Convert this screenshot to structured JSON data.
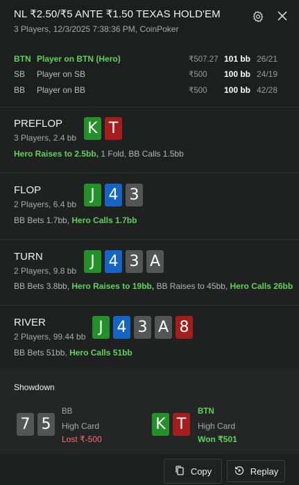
{
  "header": {
    "title": "NL ₹2.50/₹5 ANTE ₹1.50 TEXAS HOLD'EM",
    "subtitle": "3 Players, 12/3/2025 7:38:36 PM, CoinPoker"
  },
  "players": [
    {
      "pos": "BTN",
      "name": "Player on BTN (Hero)",
      "chips": "₹507.27",
      "bb": "101 bb",
      "ratio": "26/21",
      "hero": true
    },
    {
      "pos": "SB",
      "name": "Player on SB",
      "chips": "₹500",
      "bb": "100 bb",
      "ratio": "24/19",
      "hero": false
    },
    {
      "pos": "BB",
      "name": "Player on BB",
      "chips": "₹500",
      "bb": "100 bb",
      "ratio": "42/28",
      "hero": false
    }
  ],
  "streets": {
    "preflop": {
      "name": "PREFLOP",
      "info": "3 Players, 2.4 bb",
      "cards": [
        {
          "rank": "K",
          "color": "green"
        },
        {
          "rank": "T",
          "color": "red"
        }
      ],
      "action_hero": "Hero Raises to 2.5bb,",
      "action_rest": " 1 Fold, BB Calls 1.5bb"
    },
    "flop": {
      "name": "FLOP",
      "info": "2 Players, 6.4 bb",
      "cards": [
        {
          "rank": "J",
          "color": "green"
        },
        {
          "rank": "4",
          "color": "blue"
        },
        {
          "rank": "3",
          "color": "gray"
        }
      ],
      "action_pre": "BB Bets 1.7bb, ",
      "action_hero": "Hero Calls 1.7bb"
    },
    "turn": {
      "name": "TURN",
      "info": "2 Players, 9.8 bb",
      "cards": [
        {
          "rank": "J",
          "color": "green"
        },
        {
          "rank": "4",
          "color": "blue"
        },
        {
          "rank": "3",
          "color": "gray"
        },
        {
          "rank": "A",
          "color": "gray"
        }
      ],
      "action_pre": "BB Bets 3.8bb, ",
      "action_hero1": "Hero Raises to 19bb,",
      "action_mid": " BB Raises to 45bb, ",
      "action_hero2": "Hero Calls 26bb"
    },
    "river": {
      "name": "RIVER",
      "info": "2 Players, 99.44 bb",
      "cards": [
        {
          "rank": "J",
          "color": "green"
        },
        {
          "rank": "4",
          "color": "blue"
        },
        {
          "rank": "3",
          "color": "gray"
        },
        {
          "rank": "A",
          "color": "gray"
        },
        {
          "rank": "8",
          "color": "red"
        }
      ],
      "action_pre": "BB Bets 51bb, ",
      "action_hero": "Hero Calls 51bb"
    }
  },
  "showdown": {
    "title": "Showdown",
    "left": {
      "cards": [
        {
          "rank": "7",
          "color": "gray"
        },
        {
          "rank": "5",
          "color": "gray"
        }
      ],
      "pos": "BB",
      "hand": "High Card",
      "result": "Lost ₹-500"
    },
    "right": {
      "cards": [
        {
          "rank": "K",
          "color": "green"
        },
        {
          "rank": "T",
          "color": "red"
        }
      ],
      "pos": "BTN",
      "hand": "High Card",
      "result": "Won ₹501"
    }
  },
  "footer": {
    "copy_label": "Copy",
    "replay_label": "Replay"
  },
  "colors": {
    "background": "#1c1f1e",
    "hero_green": "#5fd35a",
    "card_green": "#23902a",
    "card_red": "#a41d1d",
    "card_blue": "#1565c5",
    "card_gray": "#545655",
    "loss_red": "#ff6b6b"
  },
  "icons": {
    "settings": "gear-icon",
    "close": "close-icon",
    "copy": "copy-icon",
    "replay": "replay-icon"
  }
}
